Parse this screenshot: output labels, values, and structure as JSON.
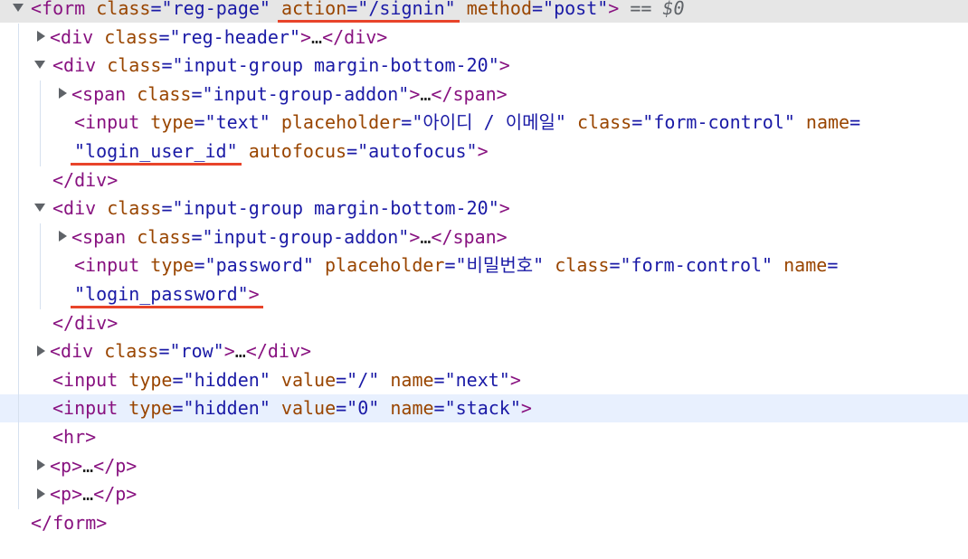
{
  "lines": [
    {
      "indent": 0,
      "toggle": "open",
      "highlight": "selected",
      "parts": [
        {
          "t": "<",
          "k": "tag"
        },
        {
          "t": "form",
          "k": "tag"
        },
        {
          "t": " "
        },
        {
          "t": "class",
          "k": "an"
        },
        {
          "t": "=\"",
          "k": "q"
        },
        {
          "t": "reg-page",
          "k": "av"
        },
        {
          "t": "\"",
          "k": "q"
        },
        {
          "t": " "
        },
        {
          "t": "action",
          "k": "an"
        },
        {
          "t": "=\"",
          "k": "q"
        },
        {
          "t": "/signin",
          "k": "av"
        },
        {
          "t": "\"",
          "k": "q"
        },
        {
          "t": " "
        },
        {
          "t": "method",
          "k": "an"
        },
        {
          "t": "=\"",
          "k": "q"
        },
        {
          "t": "post",
          "k": "av"
        },
        {
          "t": "\"",
          "k": "q"
        },
        {
          "t": ">",
          "k": "tag"
        },
        {
          "t": " == ",
          "k": "eq0"
        },
        {
          "t": "$0",
          "k": "dollar"
        }
      ]
    },
    {
      "indent": 1,
      "toggle": "closed",
      "parts": [
        {
          "t": "<div",
          "k": "tag"
        },
        {
          "t": " "
        },
        {
          "t": "class",
          "k": "an"
        },
        {
          "t": "=\"",
          "k": "q"
        },
        {
          "t": "reg-header",
          "k": "av"
        },
        {
          "t": "\"",
          "k": "q"
        },
        {
          "t": ">",
          "k": "tag"
        },
        {
          "t": "…",
          "k": "plain"
        },
        {
          "t": "</div>",
          "k": "tag"
        }
      ]
    },
    {
      "indent": 1,
      "toggle": "open",
      "parts": [
        {
          "t": "<div",
          "k": "tag"
        },
        {
          "t": " "
        },
        {
          "t": "class",
          "k": "an"
        },
        {
          "t": "=\"",
          "k": "q"
        },
        {
          "t": "input-group margin-bottom-20",
          "k": "av"
        },
        {
          "t": "\"",
          "k": "q"
        },
        {
          "t": ">",
          "k": "tag"
        }
      ]
    },
    {
      "indent": 2,
      "toggle": "closed",
      "parts": [
        {
          "t": "<span",
          "k": "tag"
        },
        {
          "t": " "
        },
        {
          "t": "class",
          "k": "an"
        },
        {
          "t": "=\"",
          "k": "q"
        },
        {
          "t": "input-group-addon",
          "k": "av"
        },
        {
          "t": "\"",
          "k": "q"
        },
        {
          "t": ">",
          "k": "tag"
        },
        {
          "t": "…",
          "k": "plain"
        },
        {
          "t": "</span>",
          "k": "tag"
        }
      ]
    },
    {
      "indent": 2,
      "toggle": "none",
      "parts": [
        {
          "t": "<input",
          "k": "tag"
        },
        {
          "t": " "
        },
        {
          "t": "type",
          "k": "an"
        },
        {
          "t": "=\"",
          "k": "q"
        },
        {
          "t": "text",
          "k": "av"
        },
        {
          "t": "\"",
          "k": "q"
        },
        {
          "t": " "
        },
        {
          "t": "placeholder",
          "k": "an"
        },
        {
          "t": "=\"",
          "k": "q"
        },
        {
          "t": "아이디 / 이메일",
          "k": "av"
        },
        {
          "t": "\"",
          "k": "q"
        },
        {
          "t": " "
        },
        {
          "t": "class",
          "k": "an"
        },
        {
          "t": "=\"",
          "k": "q"
        },
        {
          "t": "form-control",
          "k": "av"
        },
        {
          "t": "\"",
          "k": "q"
        },
        {
          "t": " "
        },
        {
          "t": "name",
          "k": "an"
        },
        {
          "t": "=",
          "k": "q"
        }
      ]
    },
    {
      "indent": 2,
      "toggle": "none",
      "parts": [
        {
          "t": "\"",
          "k": "q"
        },
        {
          "t": "login_user_id",
          "k": "av"
        },
        {
          "t": "\"",
          "k": "q"
        },
        {
          "t": " "
        },
        {
          "t": "autofocus",
          "k": "an"
        },
        {
          "t": "=\"",
          "k": "q"
        },
        {
          "t": "autofocus",
          "k": "av"
        },
        {
          "t": "\"",
          "k": "q"
        },
        {
          "t": ">",
          "k": "tag"
        }
      ]
    },
    {
      "indent": 1,
      "toggle": "none",
      "parts": [
        {
          "t": "</div>",
          "k": "tag"
        }
      ]
    },
    {
      "indent": 1,
      "toggle": "open",
      "parts": [
        {
          "t": "<div",
          "k": "tag"
        },
        {
          "t": " "
        },
        {
          "t": "class",
          "k": "an"
        },
        {
          "t": "=\"",
          "k": "q"
        },
        {
          "t": "input-group margin-bottom-20",
          "k": "av"
        },
        {
          "t": "\"",
          "k": "q"
        },
        {
          "t": ">",
          "k": "tag"
        }
      ]
    },
    {
      "indent": 2,
      "toggle": "closed",
      "parts": [
        {
          "t": "<span",
          "k": "tag"
        },
        {
          "t": " "
        },
        {
          "t": "class",
          "k": "an"
        },
        {
          "t": "=\"",
          "k": "q"
        },
        {
          "t": "input-group-addon",
          "k": "av"
        },
        {
          "t": "\"",
          "k": "q"
        },
        {
          "t": ">",
          "k": "tag"
        },
        {
          "t": "…",
          "k": "plain"
        },
        {
          "t": "</span>",
          "k": "tag"
        }
      ]
    },
    {
      "indent": 2,
      "toggle": "none",
      "parts": [
        {
          "t": "<input",
          "k": "tag"
        },
        {
          "t": " "
        },
        {
          "t": "type",
          "k": "an"
        },
        {
          "t": "=\"",
          "k": "q"
        },
        {
          "t": "password",
          "k": "av"
        },
        {
          "t": "\"",
          "k": "q"
        },
        {
          "t": " "
        },
        {
          "t": "placeholder",
          "k": "an"
        },
        {
          "t": "=\"",
          "k": "q"
        },
        {
          "t": "비밀번호",
          "k": "av"
        },
        {
          "t": "\"",
          "k": "q"
        },
        {
          "t": " "
        },
        {
          "t": "class",
          "k": "an"
        },
        {
          "t": "=\"",
          "k": "q"
        },
        {
          "t": "form-control",
          "k": "av"
        },
        {
          "t": "\"",
          "k": "q"
        },
        {
          "t": " "
        },
        {
          "t": "name",
          "k": "an"
        },
        {
          "t": "=",
          "k": "q"
        }
      ]
    },
    {
      "indent": 2,
      "toggle": "none",
      "parts": [
        {
          "t": "\"",
          "k": "q"
        },
        {
          "t": "login_password",
          "k": "av"
        },
        {
          "t": "\"",
          "k": "q"
        },
        {
          "t": ">",
          "k": "tag"
        }
      ]
    },
    {
      "indent": 1,
      "toggle": "none",
      "parts": [
        {
          "t": "</div>",
          "k": "tag"
        }
      ]
    },
    {
      "indent": 1,
      "toggle": "closed",
      "parts": [
        {
          "t": "<div",
          "k": "tag"
        },
        {
          "t": " "
        },
        {
          "t": "class",
          "k": "an"
        },
        {
          "t": "=\"",
          "k": "q"
        },
        {
          "t": "row",
          "k": "av"
        },
        {
          "t": "\"",
          "k": "q"
        },
        {
          "t": ">",
          "k": "tag"
        },
        {
          "t": "…",
          "k": "plain"
        },
        {
          "t": "</div>",
          "k": "tag"
        }
      ]
    },
    {
      "indent": 1,
      "toggle": "none",
      "parts": [
        {
          "t": "<input",
          "k": "tag"
        },
        {
          "t": " "
        },
        {
          "t": "type",
          "k": "an"
        },
        {
          "t": "=\"",
          "k": "q"
        },
        {
          "t": "hidden",
          "k": "av"
        },
        {
          "t": "\"",
          "k": "q"
        },
        {
          "t": " "
        },
        {
          "t": "value",
          "k": "an"
        },
        {
          "t": "=\"",
          "k": "q"
        },
        {
          "t": "/",
          "k": "av"
        },
        {
          "t": "\"",
          "k": "q"
        },
        {
          "t": " "
        },
        {
          "t": "name",
          "k": "an"
        },
        {
          "t": "=\"",
          "k": "q"
        },
        {
          "t": "next",
          "k": "av"
        },
        {
          "t": "\"",
          "k": "q"
        },
        {
          "t": ">",
          "k": "tag"
        }
      ]
    },
    {
      "indent": 1,
      "toggle": "none",
      "highlight": "hover",
      "parts": [
        {
          "t": "<input",
          "k": "tag"
        },
        {
          "t": " "
        },
        {
          "t": "type",
          "k": "an"
        },
        {
          "t": "=\"",
          "k": "q"
        },
        {
          "t": "hidden",
          "k": "av"
        },
        {
          "t": "\"",
          "k": "q"
        },
        {
          "t": " "
        },
        {
          "t": "value",
          "k": "an"
        },
        {
          "t": "=\"",
          "k": "q"
        },
        {
          "t": "0",
          "k": "av"
        },
        {
          "t": "\"",
          "k": "q"
        },
        {
          "t": " "
        },
        {
          "t": "name",
          "k": "an"
        },
        {
          "t": "=\"",
          "k": "q"
        },
        {
          "t": "stack",
          "k": "av"
        },
        {
          "t": "\"",
          "k": "q"
        },
        {
          "t": ">",
          "k": "tag"
        }
      ]
    },
    {
      "indent": 1,
      "toggle": "none",
      "parts": [
        {
          "t": "<hr>",
          "k": "tag"
        }
      ]
    },
    {
      "indent": 1,
      "toggle": "closed",
      "parts": [
        {
          "t": "<p>",
          "k": "tag"
        },
        {
          "t": "…",
          "k": "plain"
        },
        {
          "t": "</p>",
          "k": "tag"
        }
      ]
    },
    {
      "indent": 1,
      "toggle": "closed",
      "parts": [
        {
          "t": "<p>",
          "k": "tag"
        },
        {
          "t": "…",
          "k": "plain"
        },
        {
          "t": "</p>",
          "k": "tag"
        }
      ]
    },
    {
      "indent": 0,
      "toggle": "none",
      "parts": [
        {
          "t": "</form>",
          "k": "tag"
        }
      ]
    }
  ],
  "colors": {
    "tag": "#881280",
    "attr_name": "#994500",
    "attr_value": "#1a1aa6",
    "underline": "#e8442a",
    "hover_bg": "#e8f0fe",
    "selected_bg": "#e6e6e6"
  }
}
